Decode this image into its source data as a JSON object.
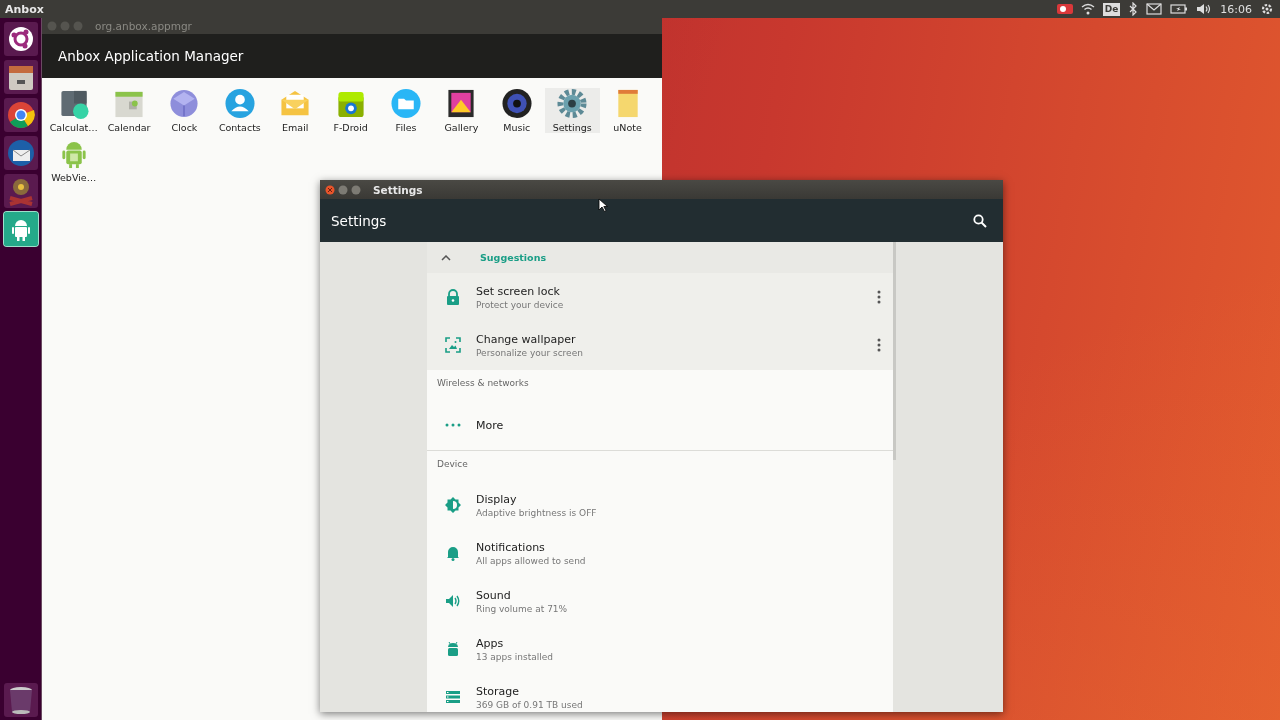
{
  "top_panel": {
    "app_name": "Anbox",
    "keyboard_layout": "De",
    "clock": "16:06"
  },
  "launcher": {
    "items": [
      {
        "kind": "dash",
        "selected": false
      },
      {
        "kind": "files",
        "selected": false
      },
      {
        "kind": "browser",
        "selected": false
      },
      {
        "kind": "mail",
        "selected": false
      },
      {
        "kind": "paint",
        "selected": false
      },
      {
        "kind": "android",
        "selected": true
      }
    ]
  },
  "app_manager": {
    "title": "org.anbox.appmgr",
    "header": "Anbox Application Manager",
    "apps": [
      {
        "label": "Calculat…",
        "kind": "calculator",
        "selected": false
      },
      {
        "label": "Calendar",
        "kind": "calendar",
        "selected": false
      },
      {
        "label": "Clock",
        "kind": "clock",
        "selected": false
      },
      {
        "label": "Contacts",
        "kind": "contacts",
        "selected": false
      },
      {
        "label": "Email",
        "kind": "email",
        "selected": false
      },
      {
        "label": "F-Droid",
        "kind": "fdroid",
        "selected": false
      },
      {
        "label": "Files",
        "kind": "files",
        "selected": false
      },
      {
        "label": "Gallery",
        "kind": "gallery",
        "selected": false
      },
      {
        "label": "Music",
        "kind": "music",
        "selected": false
      },
      {
        "label": "Settings",
        "kind": "settings",
        "selected": true
      },
      {
        "label": "uNote",
        "kind": "note",
        "selected": false
      },
      {
        "label": "WebVie…",
        "kind": "android",
        "selected": false
      }
    ]
  },
  "settings": {
    "title": "Settings",
    "toolbar_title": "Settings",
    "suggestions": {
      "label": "Suggestions",
      "expanded": true,
      "items": [
        {
          "title": "Set screen lock",
          "summary": "Protect your device",
          "kind": "lock"
        },
        {
          "title": "Change wallpaper",
          "summary": "Personalize your screen",
          "kind": "wallpaper"
        }
      ]
    },
    "sections": [
      {
        "header": "Wireless & networks",
        "items": [
          {
            "title": "More",
            "kind": "more"
          }
        ]
      },
      {
        "header": "Device",
        "items": [
          {
            "title": "Display",
            "summary": "Adaptive brightness is OFF",
            "kind": "display"
          },
          {
            "title": "Notifications",
            "summary": "All apps allowed to send",
            "kind": "bell"
          },
          {
            "title": "Sound",
            "summary": "Ring volume at 71%",
            "kind": "sound"
          },
          {
            "title": "Apps",
            "summary": "13 apps installed",
            "kind": "apps"
          },
          {
            "title": "Storage",
            "summary": "369 GB of 0.91 TB used",
            "kind": "storage"
          }
        ]
      }
    ]
  }
}
